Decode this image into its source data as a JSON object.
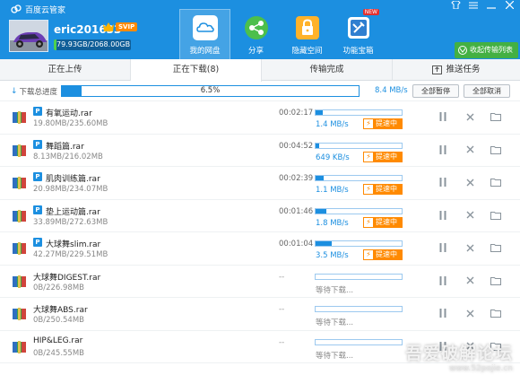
{
  "app": {
    "title": "百度云管家",
    "window_controls": [
      "皮肤",
      "菜单",
      "最小化",
      "关闭"
    ]
  },
  "user": {
    "name": "eric201633",
    "vip": "SVIP",
    "quota": "79.93GB/2068.00GB",
    "quota_used_fraction": 0.0387
  },
  "nav": {
    "items": [
      {
        "label": "我的网盘",
        "icon": "cloud-icon",
        "active": true
      },
      {
        "label": "分享",
        "icon": "share-icon",
        "active": false
      },
      {
        "label": "隐藏空间",
        "icon": "lock-icon",
        "active": false
      },
      {
        "label": "功能宝箱",
        "icon": "toolbox-icon",
        "active": false,
        "badge": "NEW"
      }
    ]
  },
  "collect_button": {
    "label": "收起传输列表"
  },
  "tabs": [
    {
      "label": "正在上传"
    },
    {
      "label": "正在下载(8)",
      "active": true
    },
    {
      "label": "传输完成"
    },
    {
      "label": "推送任务"
    }
  ],
  "total": {
    "label": "下载总进度",
    "percent": 6.5,
    "percent_text": "6.5%",
    "speed": "8.4 MB/s",
    "pause_all": "全部暂停",
    "cancel_all": "全部取消"
  },
  "colors": {
    "brand_blue": "#1c8fe0",
    "accent_orange": "#ff8a00",
    "green": "#43b043"
  },
  "downloads": [
    {
      "name": "有氧运动.rar",
      "p": true,
      "size": "19.80MB/235.60MB",
      "time": "00:02:17",
      "progress": 0.084,
      "speed": "1.4 MB/s",
      "boost": "提速中"
    },
    {
      "name": "舞蹈篇.rar",
      "p": true,
      "size": "8.13MB/216.02MB",
      "time": "00:04:52",
      "progress": 0.038,
      "speed": "649 KB/s",
      "boost": "提速中"
    },
    {
      "name": "肌肉训练篇.rar",
      "p": true,
      "size": "20.98MB/234.07MB",
      "time": "00:02:39",
      "progress": 0.09,
      "speed": "1.1 MB/s",
      "boost": "提速中"
    },
    {
      "name": "垫上运动篇.rar",
      "p": true,
      "size": "33.89MB/272.63MB",
      "time": "00:01:46",
      "progress": 0.124,
      "speed": "1.8 MB/s",
      "boost": "提速中"
    },
    {
      "name": "大球舞slim.rar",
      "p": true,
      "size": "42.27MB/229.51MB",
      "time": "00:01:04",
      "progress": 0.184,
      "speed": "3.5 MB/s",
      "boost": "提速中"
    },
    {
      "name": "大球舞DIGEST.rar",
      "p": false,
      "size": "0B/226.98MB",
      "time": "--",
      "progress": 0,
      "speed": "等待下载...",
      "boost": ""
    },
    {
      "name": "大球舞ABS.rar",
      "p": false,
      "size": "0B/250.54MB",
      "time": "--",
      "progress": 0,
      "speed": "等待下载...",
      "boost": ""
    },
    {
      "name": "HIP&LEG.rar",
      "p": false,
      "size": "0B/245.55MB",
      "time": "--",
      "progress": 0,
      "speed": "等待下载...",
      "boost": ""
    }
  ],
  "watermark": {
    "line1": "吾爱破解论坛",
    "line2": "www.52pojie.cn"
  }
}
